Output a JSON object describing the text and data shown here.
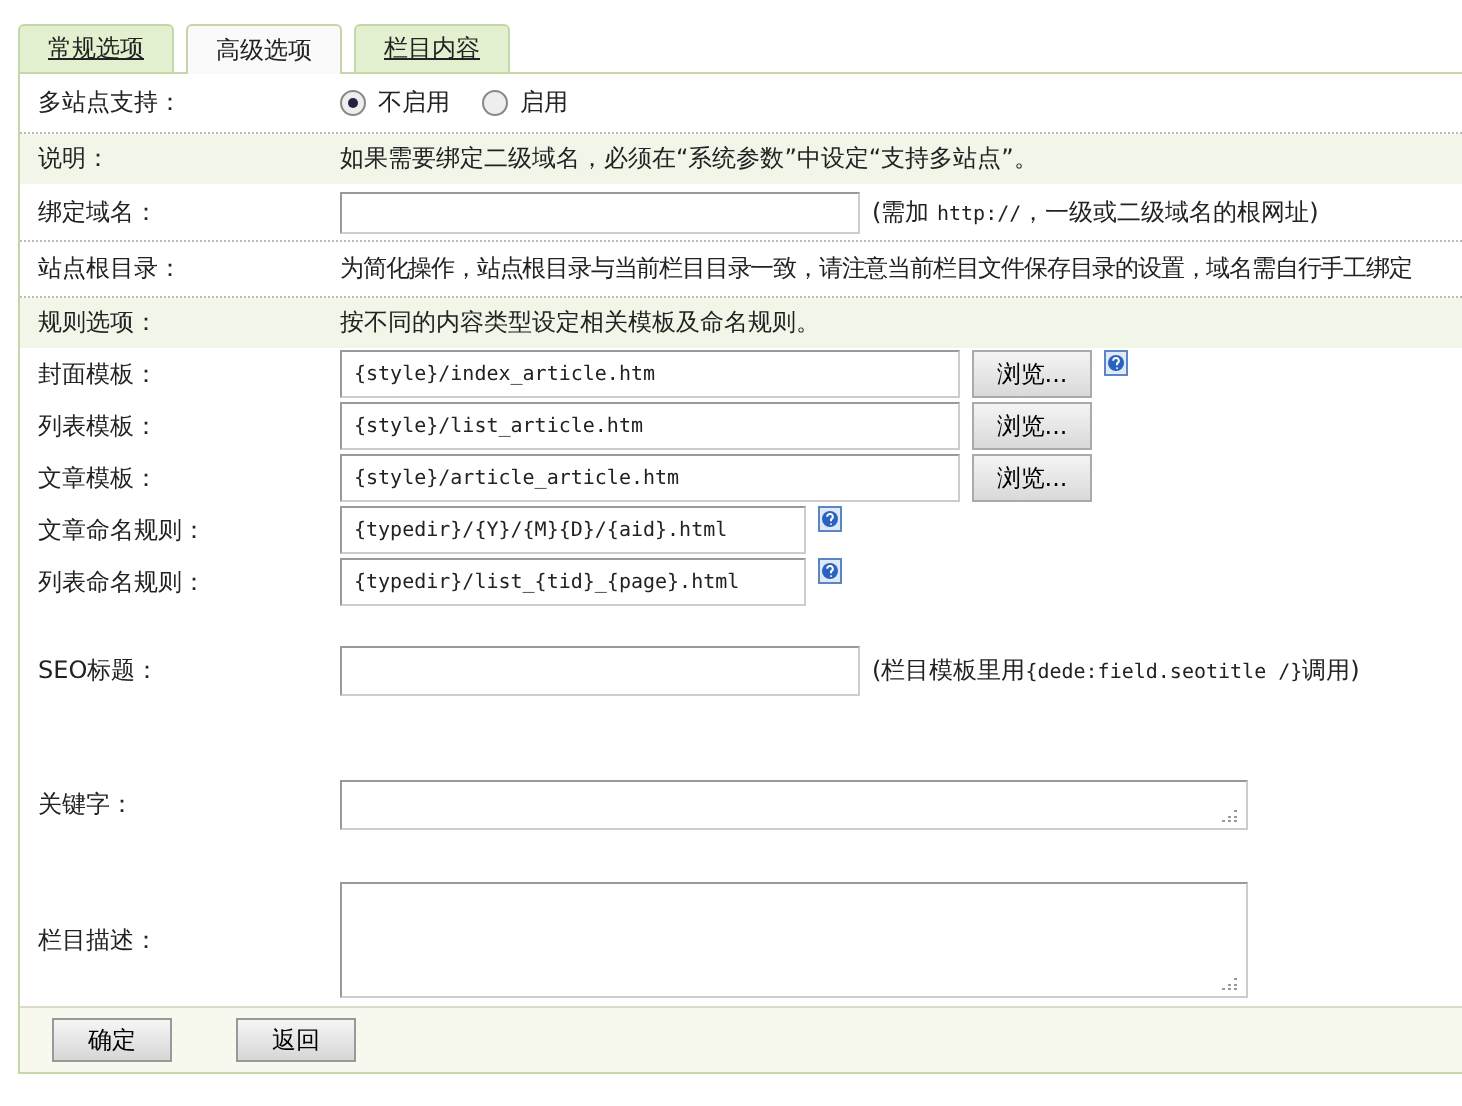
{
  "tabs": [
    {
      "label": "常规选项",
      "selected": false
    },
    {
      "label": "高级选项",
      "selected": true
    },
    {
      "label": "栏目内容",
      "selected": false
    }
  ],
  "rows": [
    {
      "kind": "radio",
      "label": "多站点支持：",
      "options": [
        {
          "label": "不启用",
          "selected": true
        },
        {
          "label": "启用",
          "selected": false
        }
      ]
    },
    {
      "kind": "note",
      "label": "说明：",
      "text": "如果需要绑定二级域名，必须在“系统参数”中设定“支持多站点”。"
    },
    {
      "kind": "field",
      "label": "绑定域名：",
      "hint": [
        {
          "text": "(需加 "
        },
        {
          "text": "http://",
          "code": true
        },
        {
          "text": "，一级或二级域名的根网址)"
        }
      ]
    },
    {
      "kind": "text",
      "label": "站点根目录：",
      "text": "为简化操作，站点根目录与当前栏目目录一致，请注意当前栏目文件保存目录的设置，域名需自行手工绑定"
    },
    {
      "kind": "note",
      "label": "规则选项：",
      "text": "按不同的内容类型设定相关模板及命名规则。"
    },
    {
      "kind": "template",
      "label": "封面模板：",
      "value": "{style}/index_article.htm",
      "button": "浏览...",
      "help": true
    },
    {
      "kind": "template",
      "label": "列表模板：",
      "value": "{style}/list_article.htm",
      "button": "浏览...",
      "help": false
    },
    {
      "kind": "template",
      "label": "文章模板：",
      "value": "{style}/article_article.htm",
      "button": "浏览...",
      "help": false
    },
    {
      "kind": "rule",
      "label": "文章命名规则：",
      "value": "{typedir}/{Y}/{M}{D}/{aid}.html",
      "help": true
    },
    {
      "kind": "rule",
      "label": "列表命名规则：",
      "value": "{typedir}/list_{tid}_{page}.html",
      "help": true
    },
    {
      "kind": "seo",
      "label": "SEO标题：",
      "hint": [
        {
          "text": "(栏目模板里用"
        },
        {
          "text": "{dede:field.seotitle /}",
          "code": true
        },
        {
          "text": "调用)"
        }
      ]
    },
    {
      "kind": "keywords",
      "label": "关键字："
    },
    {
      "kind": "description",
      "label": "栏目描述："
    }
  ],
  "footer": {
    "buttons": [
      "确定",
      "返回"
    ]
  }
}
